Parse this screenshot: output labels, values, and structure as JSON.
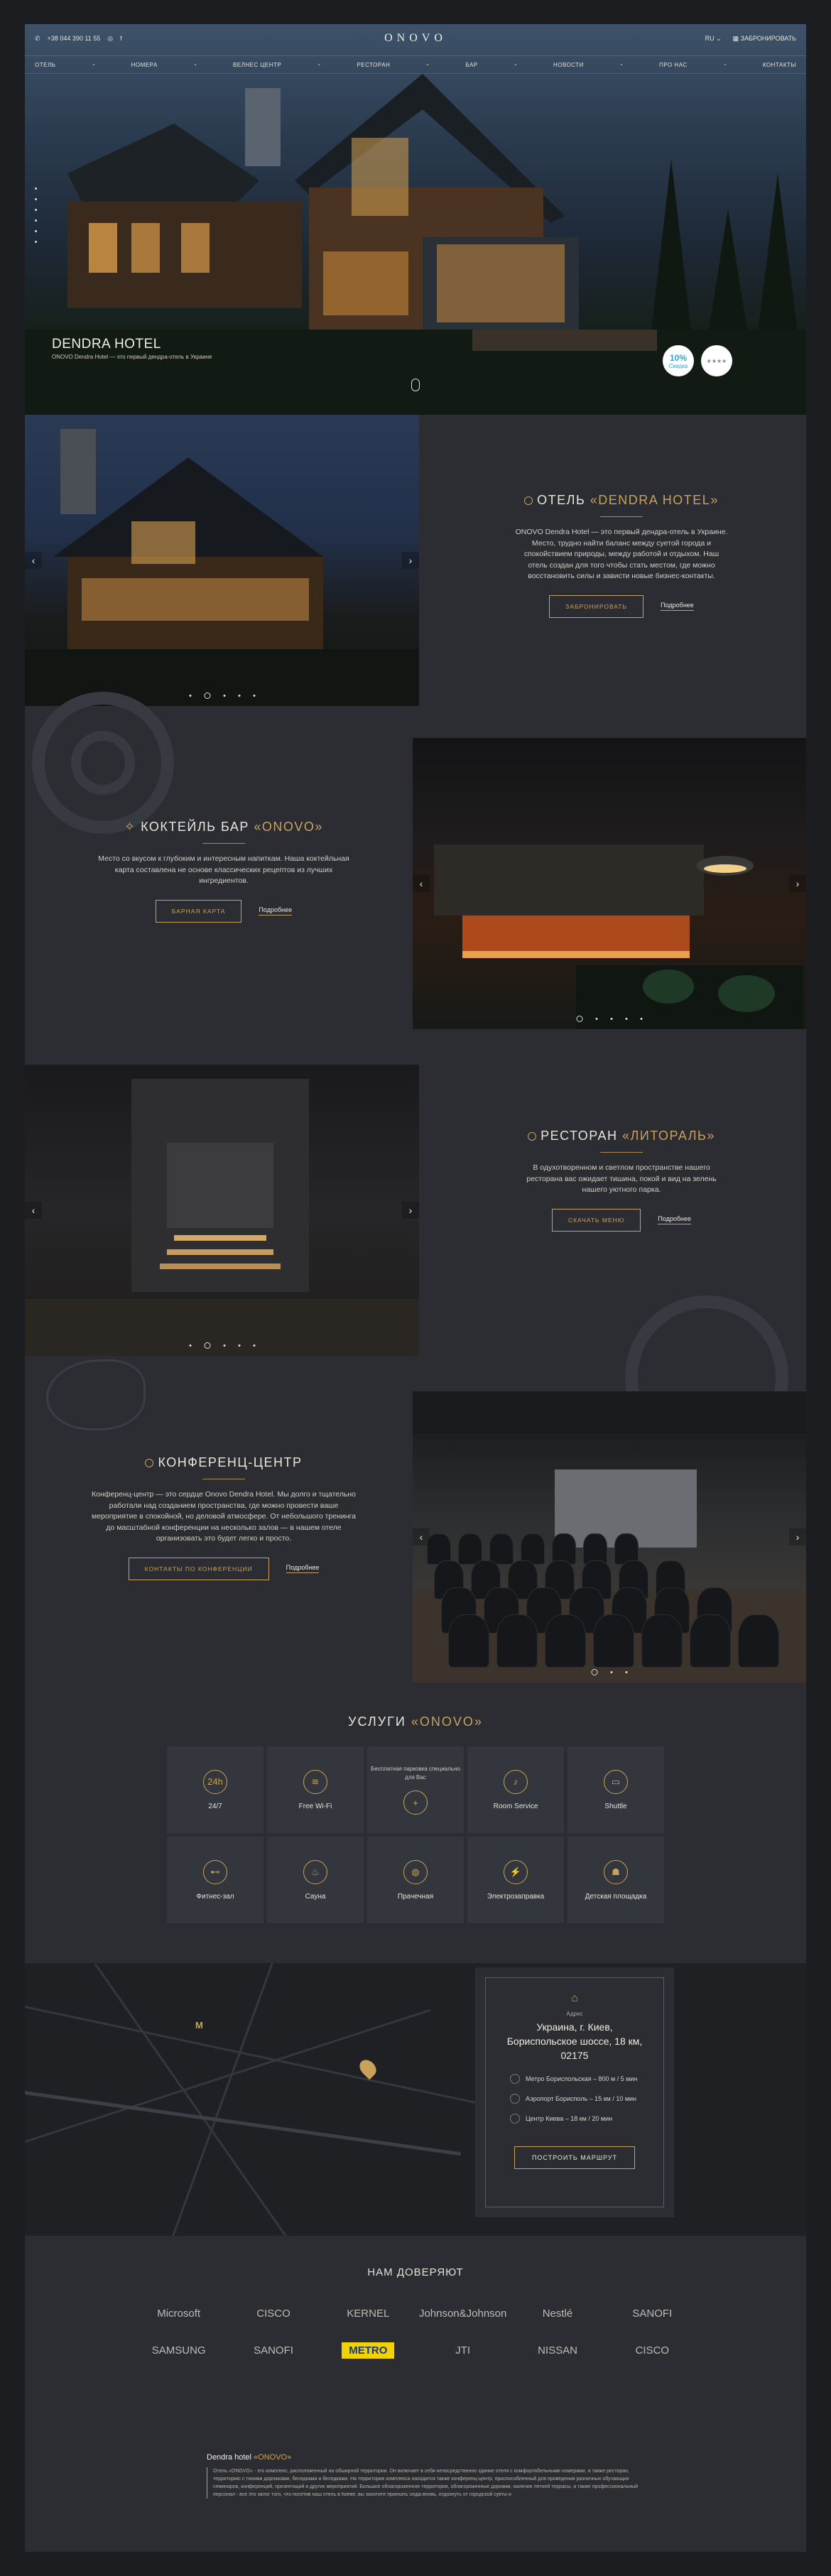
{
  "topbar": {
    "phone": "+38 044 390 11 55",
    "logo": "ONOVO",
    "lang": "RU ⌄",
    "book": "ЗАБРОНИРОВАТЬ"
  },
  "nav": [
    "ОТЕЛЬ",
    "НОМЕРА",
    "ВЕЛНЕС ЦЕНТР",
    "РЕСТОРАН",
    "БАР",
    "НОВОСТИ",
    "ПРО НАС",
    "КОНТАКТЫ"
  ],
  "hero": {
    "title": "DENDRA HOTEL",
    "subtitle": "ONOVO Dendra Hotel — это первый дендра-отель в Украине",
    "badge1_top": "10%",
    "badge1_bottom": "Скидка",
    "badge2": "★★★★"
  },
  "hotel": {
    "title_pre": "ОТЕЛЬ ",
    "title_gold": "«DENDRA HOTEL»",
    "text": "ONOVO Dendra Hotel — это первый дендра-отель в Украине. Место, трудно найти баланс между суетой города и спокойствием природы, между работой и отдыхом. Наш отель создан для того чтобы стать местом, где можно восстановить силы и зависти новые бизнес-контакты.",
    "btn": "ЗАБРОНИРОВАТЬ",
    "more": "Подробнее"
  },
  "bar": {
    "title_pre": "КОКТЕЙЛЬ БАР ",
    "title_gold": "«ONOVO»",
    "text": "Место со вкусом к глубоким и интересным напиткам. Наша коктейльная карта составлена не основе классических рецептов из лучших ингредиентов.",
    "btn": "БАРНАЯ КАРТА",
    "more": "Подробнее"
  },
  "restaurant": {
    "title_pre": "РЕСТОРАН ",
    "title_gold": "«ЛИТОРАЛЬ»",
    "text": "В одухотворенном и светлом пространстве нашего ресторана вас ожидает тишина, покой и вид на зелень нашего уютного парка.",
    "btn": "СКАЧАТЬ МЕНЮ",
    "more": "Подробнее"
  },
  "conference": {
    "title": "КОНФЕРЕНЦ-ЦЕНТР",
    "text": "Конференц-центр — это сердце Onovo Dendra Hotel. Мы долго и тщательно работали над созданием пространства, где можно провести ваше мероприятие в спокойной, но деловой атмосфере. От небольшого тренинга до масштабной конференции на несколько залов — в нашем отеле организовать это будет легко и просто.",
    "btn": "КОНТАКТЫ ПО КОНФЕРЕНЦИИ",
    "more": "Подробнее"
  },
  "services": {
    "title_pre": "УСЛУГИ ",
    "title_gold": "«ONOVO»",
    "items": [
      {
        "label": "24/7",
        "icon": "24h"
      },
      {
        "label": "Free Wi-Fi",
        "icon": "wifi"
      },
      {
        "label": "Бесплатная парковка специально для Вас",
        "icon": "plus"
      },
      {
        "label": "Room Service",
        "icon": "bell"
      },
      {
        "label": "Shuttle",
        "icon": "bus"
      },
      {
        "label": "Фитнес-зал",
        "icon": "dumbbell"
      },
      {
        "label": "Сауна",
        "icon": "sauna"
      },
      {
        "label": "Прачечная",
        "icon": "laundry"
      },
      {
        "label": "Электрозаправка",
        "icon": "ev"
      },
      {
        "label": "Детская площадка",
        "icon": "kids"
      }
    ]
  },
  "map": {
    "label": "Адрес",
    "address": "Украина, г. Киев, Бориспольское шоссе, 18 км, 02175",
    "rows": [
      "Метро Бориспольская – 800 м / 5 мин",
      "Аэропорт Борисполь – 15 км / 10 мин",
      "Центр Киева – 18 км / 20 мин"
    ],
    "route": "ПОСТРОИТЬ МАРШРУТ"
  },
  "trust": {
    "title": "НАМ ДОВЕРЯЮТ",
    "logos": [
      "Microsoft",
      "CISCO",
      "KERNEL",
      "Johnson&Johnson",
      "Nestlé",
      "SANOFI",
      "SAMSUNG",
      "SANOFI",
      "METRO",
      "JTI",
      "NISSAN",
      "CISCO"
    ]
  },
  "seo": {
    "title_pre": "Dendra hotel ",
    "title_gold": "«ONOVO»",
    "text": "Отель «ONOVO» - это комплекс, расположенный на обширной территории. Он включает в себя непосредственно здание отеля с комфортабельными номерами, а также ресторан, территорию с тихими дорожками, беседками и беседками. На территории комплекса находится также конференц-центр, приспособленный для проведения различных обучающих семинаров, конференций, презентаций и других мероприятий. Большое облагороженное территория, облагороженные дорожки, наличие летней террасы, а также профессиональный персонал - все это залог того, что посетив наш отель в Киеве, вы захотите приехать сюда вновь, отдохнуть от городской суеты и"
  }
}
